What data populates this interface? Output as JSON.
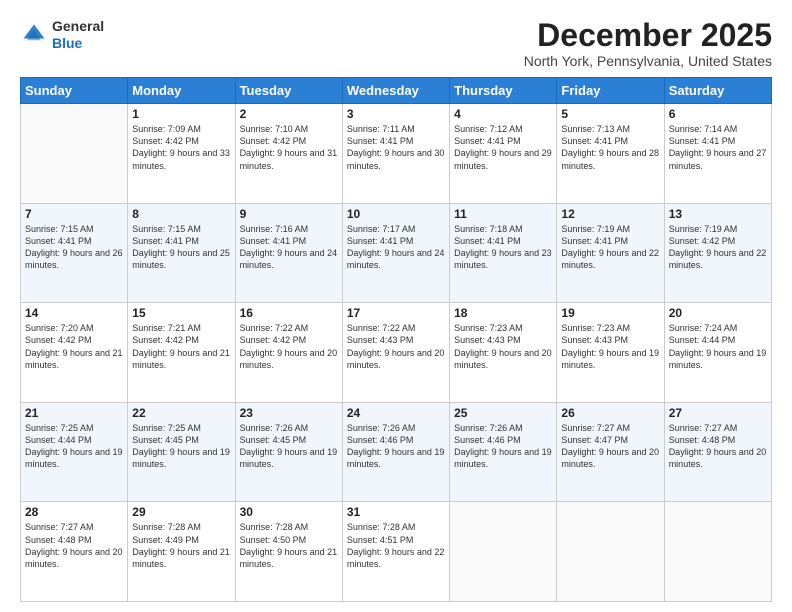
{
  "header": {
    "logo_general": "General",
    "logo_blue": "Blue",
    "month_title": "December 2025",
    "location": "North York, Pennsylvania, United States"
  },
  "weekdays": [
    "Sunday",
    "Monday",
    "Tuesday",
    "Wednesday",
    "Thursday",
    "Friday",
    "Saturday"
  ],
  "weeks": [
    [
      {
        "day": "",
        "sunrise": "",
        "sunset": "",
        "daylight": "",
        "empty": true
      },
      {
        "day": "1",
        "sunrise": "Sunrise: 7:09 AM",
        "sunset": "Sunset: 4:42 PM",
        "daylight": "Daylight: 9 hours and 33 minutes."
      },
      {
        "day": "2",
        "sunrise": "Sunrise: 7:10 AM",
        "sunset": "Sunset: 4:42 PM",
        "daylight": "Daylight: 9 hours and 31 minutes."
      },
      {
        "day": "3",
        "sunrise": "Sunrise: 7:11 AM",
        "sunset": "Sunset: 4:41 PM",
        "daylight": "Daylight: 9 hours and 30 minutes."
      },
      {
        "day": "4",
        "sunrise": "Sunrise: 7:12 AM",
        "sunset": "Sunset: 4:41 PM",
        "daylight": "Daylight: 9 hours and 29 minutes."
      },
      {
        "day": "5",
        "sunrise": "Sunrise: 7:13 AM",
        "sunset": "Sunset: 4:41 PM",
        "daylight": "Daylight: 9 hours and 28 minutes."
      },
      {
        "day": "6",
        "sunrise": "Sunrise: 7:14 AM",
        "sunset": "Sunset: 4:41 PM",
        "daylight": "Daylight: 9 hours and 27 minutes."
      }
    ],
    [
      {
        "day": "7",
        "sunrise": "Sunrise: 7:15 AM",
        "sunset": "Sunset: 4:41 PM",
        "daylight": "Daylight: 9 hours and 26 minutes."
      },
      {
        "day": "8",
        "sunrise": "Sunrise: 7:15 AM",
        "sunset": "Sunset: 4:41 PM",
        "daylight": "Daylight: 9 hours and 25 minutes."
      },
      {
        "day": "9",
        "sunrise": "Sunrise: 7:16 AM",
        "sunset": "Sunset: 4:41 PM",
        "daylight": "Daylight: 9 hours and 24 minutes."
      },
      {
        "day": "10",
        "sunrise": "Sunrise: 7:17 AM",
        "sunset": "Sunset: 4:41 PM",
        "daylight": "Daylight: 9 hours and 24 minutes."
      },
      {
        "day": "11",
        "sunrise": "Sunrise: 7:18 AM",
        "sunset": "Sunset: 4:41 PM",
        "daylight": "Daylight: 9 hours and 23 minutes."
      },
      {
        "day": "12",
        "sunrise": "Sunrise: 7:19 AM",
        "sunset": "Sunset: 4:41 PM",
        "daylight": "Daylight: 9 hours and 22 minutes."
      },
      {
        "day": "13",
        "sunrise": "Sunrise: 7:19 AM",
        "sunset": "Sunset: 4:42 PM",
        "daylight": "Daylight: 9 hours and 22 minutes."
      }
    ],
    [
      {
        "day": "14",
        "sunrise": "Sunrise: 7:20 AM",
        "sunset": "Sunset: 4:42 PM",
        "daylight": "Daylight: 9 hours and 21 minutes."
      },
      {
        "day": "15",
        "sunrise": "Sunrise: 7:21 AM",
        "sunset": "Sunset: 4:42 PM",
        "daylight": "Daylight: 9 hours and 21 minutes."
      },
      {
        "day": "16",
        "sunrise": "Sunrise: 7:22 AM",
        "sunset": "Sunset: 4:42 PM",
        "daylight": "Daylight: 9 hours and 20 minutes."
      },
      {
        "day": "17",
        "sunrise": "Sunrise: 7:22 AM",
        "sunset": "Sunset: 4:43 PM",
        "daylight": "Daylight: 9 hours and 20 minutes."
      },
      {
        "day": "18",
        "sunrise": "Sunrise: 7:23 AM",
        "sunset": "Sunset: 4:43 PM",
        "daylight": "Daylight: 9 hours and 20 minutes."
      },
      {
        "day": "19",
        "sunrise": "Sunrise: 7:23 AM",
        "sunset": "Sunset: 4:43 PM",
        "daylight": "Daylight: 9 hours and 19 minutes."
      },
      {
        "day": "20",
        "sunrise": "Sunrise: 7:24 AM",
        "sunset": "Sunset: 4:44 PM",
        "daylight": "Daylight: 9 hours and 19 minutes."
      }
    ],
    [
      {
        "day": "21",
        "sunrise": "Sunrise: 7:25 AM",
        "sunset": "Sunset: 4:44 PM",
        "daylight": "Daylight: 9 hours and 19 minutes."
      },
      {
        "day": "22",
        "sunrise": "Sunrise: 7:25 AM",
        "sunset": "Sunset: 4:45 PM",
        "daylight": "Daylight: 9 hours and 19 minutes."
      },
      {
        "day": "23",
        "sunrise": "Sunrise: 7:26 AM",
        "sunset": "Sunset: 4:45 PM",
        "daylight": "Daylight: 9 hours and 19 minutes."
      },
      {
        "day": "24",
        "sunrise": "Sunrise: 7:26 AM",
        "sunset": "Sunset: 4:46 PM",
        "daylight": "Daylight: 9 hours and 19 minutes."
      },
      {
        "day": "25",
        "sunrise": "Sunrise: 7:26 AM",
        "sunset": "Sunset: 4:46 PM",
        "daylight": "Daylight: 9 hours and 19 minutes."
      },
      {
        "day": "26",
        "sunrise": "Sunrise: 7:27 AM",
        "sunset": "Sunset: 4:47 PM",
        "daylight": "Daylight: 9 hours and 20 minutes."
      },
      {
        "day": "27",
        "sunrise": "Sunrise: 7:27 AM",
        "sunset": "Sunset: 4:48 PM",
        "daylight": "Daylight: 9 hours and 20 minutes."
      }
    ],
    [
      {
        "day": "28",
        "sunrise": "Sunrise: 7:27 AM",
        "sunset": "Sunset: 4:48 PM",
        "daylight": "Daylight: 9 hours and 20 minutes."
      },
      {
        "day": "29",
        "sunrise": "Sunrise: 7:28 AM",
        "sunset": "Sunset: 4:49 PM",
        "daylight": "Daylight: 9 hours and 21 minutes."
      },
      {
        "day": "30",
        "sunrise": "Sunrise: 7:28 AM",
        "sunset": "Sunset: 4:50 PM",
        "daylight": "Daylight: 9 hours and 21 minutes."
      },
      {
        "day": "31",
        "sunrise": "Sunrise: 7:28 AM",
        "sunset": "Sunset: 4:51 PM",
        "daylight": "Daylight: 9 hours and 22 minutes."
      },
      {
        "day": "",
        "sunrise": "",
        "sunset": "",
        "daylight": "",
        "empty": true
      },
      {
        "day": "",
        "sunrise": "",
        "sunset": "",
        "daylight": "",
        "empty": true
      },
      {
        "day": "",
        "sunrise": "",
        "sunset": "",
        "daylight": "",
        "empty": true
      }
    ]
  ]
}
